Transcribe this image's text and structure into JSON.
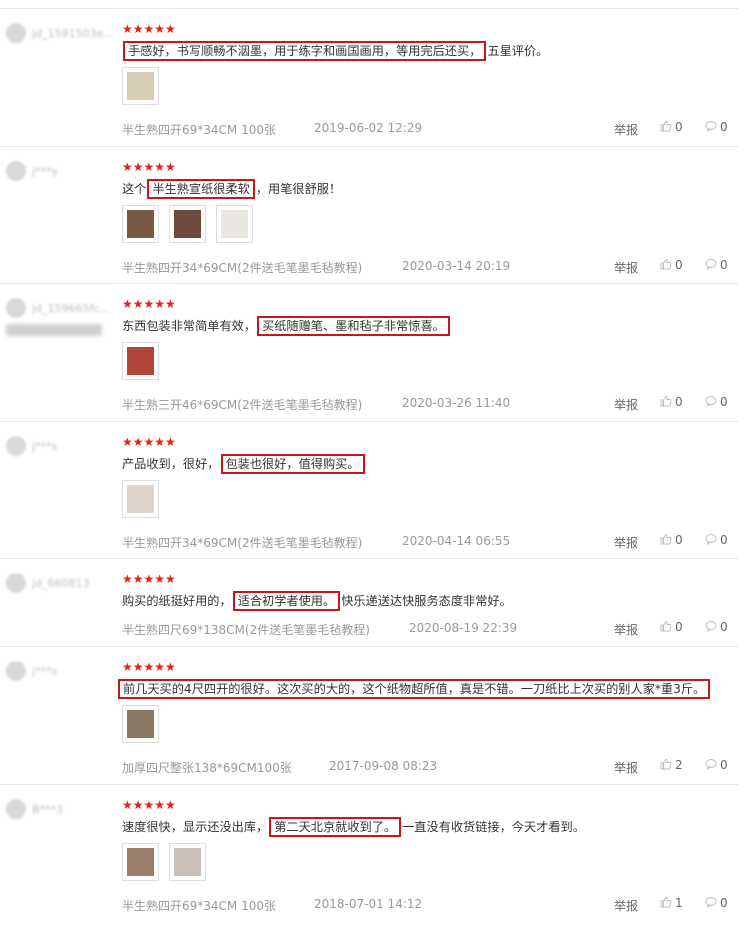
{
  "report_label": "举报",
  "reviews": [
    {
      "user": "jd_1591503e...",
      "stars": "★★★★★",
      "text_pre": "",
      "highlight": "手感好，书写顺畅不洇墨，用于练字和画国画用，等用完后还买，",
      "text_post": "五星评价。",
      "spec": "半生熟四开69*34CM 100张",
      "date": "2019-06-02 12:29",
      "likes": "0",
      "replies": "0",
      "thumbs": [
        "#d8ceb6"
      ]
    },
    {
      "user": "j***y",
      "stars": "★★★★★",
      "text_pre": "这个",
      "highlight": "半生熟宣纸很柔软",
      "text_post": "，用笔很舒服！",
      "spec": "半生熟四开34*69CM(2件送毛笔墨毛毡教程)",
      "date": "2020-03-14 20:19",
      "likes": "0",
      "replies": "0",
      "thumbs": [
        "#7a5a45",
        "#6e4a40",
        "#e9e6e2"
      ]
    },
    {
      "user": "jd_159665fc...",
      "stars": "★★★★★",
      "text_pre": "东西包装非常简单有效，",
      "highlight": "买纸随赠笔、墨和毡子非常惊喜。",
      "text_post": "",
      "spec": "半生熟三开46*69CM(2件送毛笔墨毛毡教程)",
      "date": "2020-03-26 11:40",
      "likes": "0",
      "replies": "0",
      "thumbs": [
        "#b0453a"
      ]
    },
    {
      "user": "j***s",
      "stars": "★★★★★",
      "text_pre": "产品收到，很好，",
      "highlight": "包装也很好，值得购买。",
      "text_post": "",
      "spec": "半生熟四开34*69CM(2件送毛笔墨毛毡教程)",
      "date": "2020-04-14 06:55",
      "likes": "0",
      "replies": "0",
      "thumbs": [
        "#ddd3c8"
      ]
    },
    {
      "user": "jd_660813",
      "stars": "★★★★★",
      "text_pre": "购买的纸挺好用的，",
      "highlight": "适合初学者使用。",
      "text_post": "快乐递送达快服务态度非常好。",
      "spec": "半生熟四尺69*138CM(2件送毛笔墨毛毡教程)",
      "date": "2020-08-19 22:39",
      "likes": "0",
      "replies": "0",
      "thumbs": []
    },
    {
      "user": "j***s",
      "stars": "★★★★★",
      "text_pre": "",
      "highlight": "前几天买的4尺四开的很好。这次买的大的，这个纸物超所值，真是不错。一刀纸比上次买的别人家*重3斤。",
      "text_post": "",
      "spec": "加厚四尺整张138*69CM100张",
      "date": "2017-09-08 08:23",
      "likes": "2",
      "replies": "0",
      "thumbs": [
        "#8a7a66"
      ]
    },
    {
      "user": "B***3",
      "stars": "★★★★★",
      "text_pre": "速度很快，显示还没出库，",
      "highlight": "第二天北京就收到了。",
      "text_post": "一直没有收货链接，今天才看到。",
      "spec": "半生熟四开69*34CM 100张",
      "date": "2018-07-01 14:12",
      "likes": "1",
      "replies": "0",
      "thumbs": [
        "#9a7d6a",
        "#c9bfb8"
      ]
    }
  ]
}
